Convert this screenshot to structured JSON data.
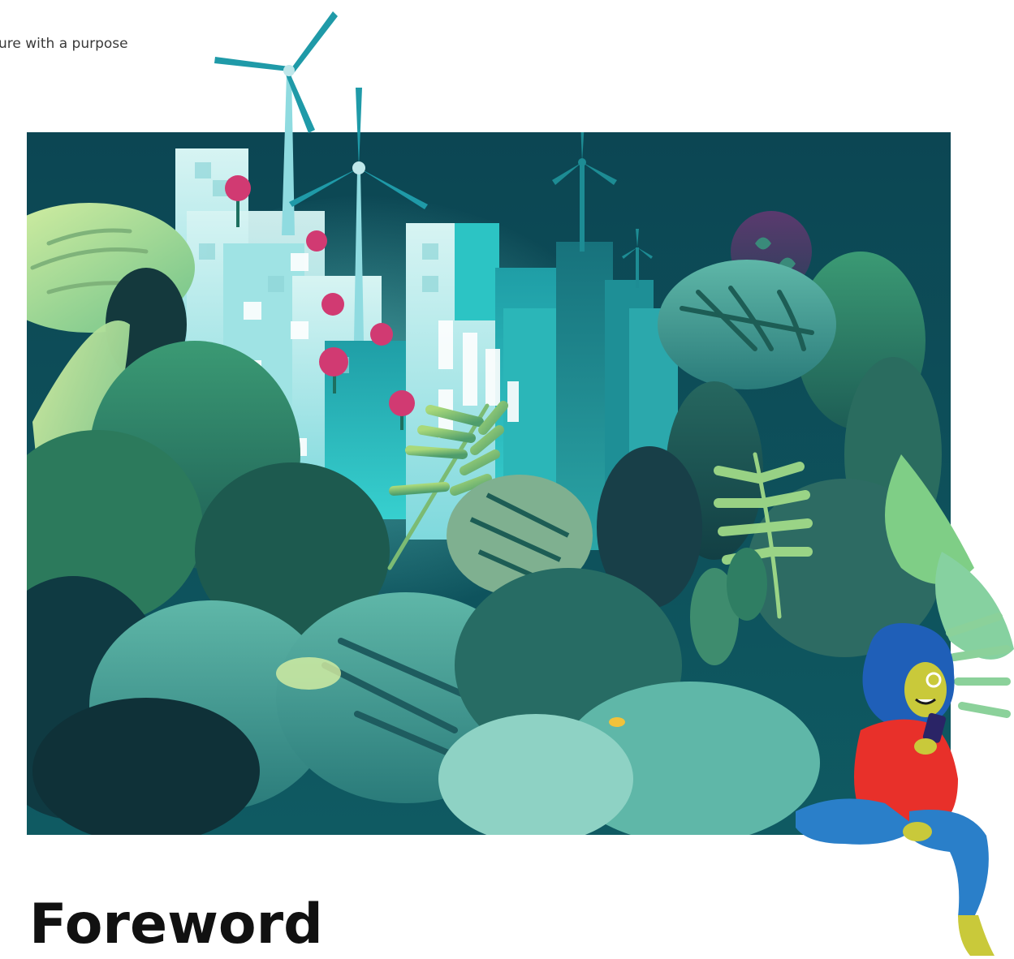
{
  "header": {
    "running_title": "ure with a purpose"
  },
  "section": {
    "title": "Foreword"
  },
  "illustration": {
    "scene": "city-with-wind-turbines-and-jungle-foliage",
    "figure": "person-sitting-with-phone",
    "colors": {
      "sky": "#0d4a57",
      "building_light": "#bfeef0",
      "building_teal": "#27b0b4",
      "foliage_dark": "#1d5c55",
      "foliage_mid": "#2d8a6a",
      "foliage_light": "#a6e08a",
      "flower_pink": "#d6336c",
      "hair_blue": "#1f5fb8",
      "shirt_red": "#e8302a",
      "pants_blue": "#2a7fc9",
      "skin_yellow": "#c9c93a"
    }
  }
}
